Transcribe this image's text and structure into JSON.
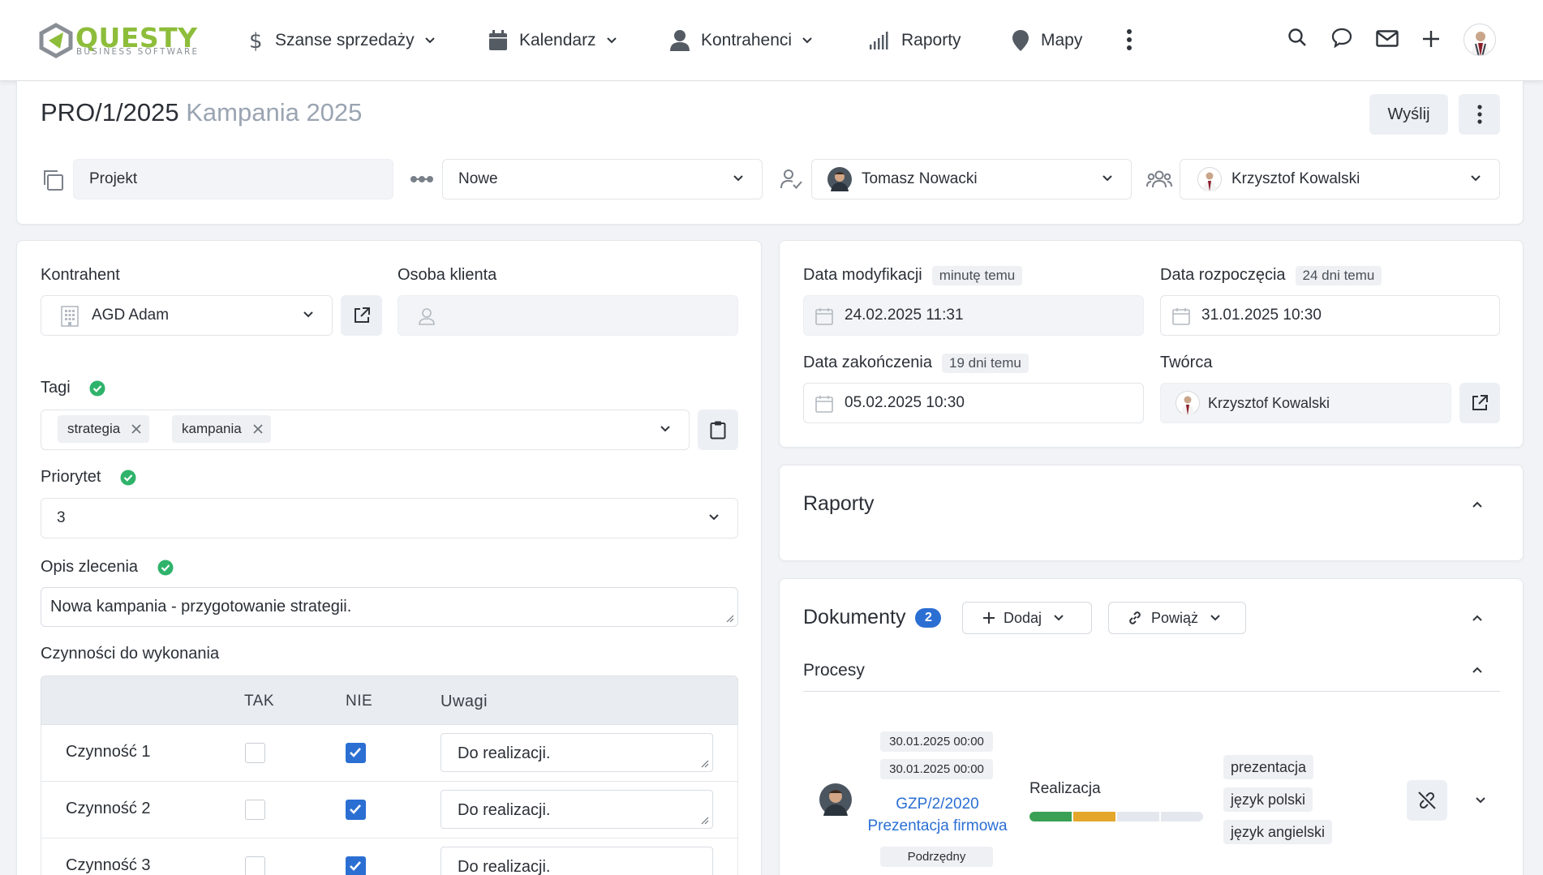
{
  "logo": {
    "word": "QUESTY",
    "sub": "BUSINESS SOFTWARE"
  },
  "nav": {
    "sales": "Szanse sprzedaży",
    "calendar": "Kalendarz",
    "contractors": "Kontrahenci",
    "reports": "Raporty",
    "maps": "Mapy"
  },
  "header": {
    "number": "PRO/1/2025",
    "name": "Kampania 2025",
    "send_label": "Wyślij",
    "type": "Projekt",
    "status": "Nowe",
    "owner": "Tomasz Nowacki",
    "participant": "Krzysztof Kowalski"
  },
  "left": {
    "contractor_label": "Kontrahent",
    "contractor_value": "AGD Adam",
    "client_person_label": "Osoba klienta",
    "tags_label": "Tagi",
    "tags": [
      "strategia",
      "kampania"
    ],
    "priority_label": "Priorytet",
    "priority_value": "3",
    "description_label": "Opis zlecenia",
    "description_value": "Nowa kampania - przygotowanie strategii.",
    "tasks_label": "Czynności do wykonania",
    "tasks_columns": [
      "TAK",
      "NIE",
      "Uwagi"
    ],
    "tasks": [
      {
        "name": "Czynność 1",
        "yes": false,
        "no": true,
        "note": "Do realizacji."
      },
      {
        "name": "Czynność 2",
        "yes": false,
        "no": true,
        "note": "Do realizacji."
      },
      {
        "name": "Czynność 3",
        "yes": false,
        "no": true,
        "note": "Do realizacji."
      }
    ]
  },
  "right": {
    "modified_label": "Data modyfikacji",
    "modified_ago": "minutę temu",
    "modified_value": "24.02.2025 11:31",
    "start_label": "Data rozpoczęcia",
    "start_ago": "24 dni temu",
    "start_value": "31.01.2025 10:30",
    "end_label": "Data zakończenia",
    "end_ago": "19 dni temu",
    "end_value": "05.02.2025 10:30",
    "creator_label": "Twórca",
    "creator_value": "Krzysztof Kowalski"
  },
  "reports_panel": {
    "title": "Raporty"
  },
  "documents": {
    "title": "Dokumenty",
    "count": "2",
    "add_label": "Dodaj",
    "link_label": "Powiąż",
    "section": "Procesy",
    "item": {
      "date1": "30.01.2025 00:00",
      "date2": "30.01.2025 00:00",
      "number": "GZP/2/2020",
      "name": "Prezentacja firmowa",
      "relation": "Podrzędny",
      "stage": "Realizacja",
      "keywords": [
        "prezentacja",
        "język polski",
        "język angielski"
      ],
      "progress_colors": [
        "#3aa055",
        "#e4a62b",
        "#e4e8ee",
        "#e4e8ee"
      ]
    }
  },
  "colors": {
    "accent": "#2b6fd3",
    "brand": "#8dbd3a",
    "ok": "#2fb36b"
  }
}
